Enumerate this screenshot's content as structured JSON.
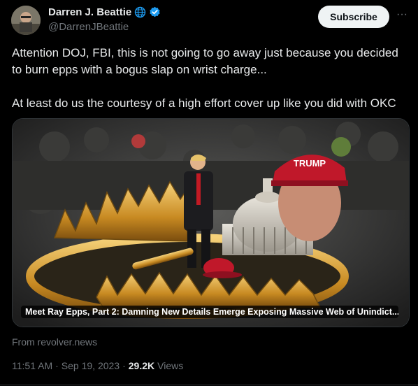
{
  "author": {
    "name": "Darren J. Beattie",
    "handle": "@DarrenJBeattie"
  },
  "actions": {
    "subscribe_label": "Subscribe",
    "more_label": "···"
  },
  "tweet": {
    "text": "Attention DOJ, FBI, this is not going to go away just because you decided to burn epps with a bogus slap on wrist charge...\n\nAt least do us the courtesy of a high effort cover up like you did with OKC"
  },
  "card": {
    "title": "Meet Ray Epps, Part 2: Damning New Details Emerge Exposing Massive Web of Unindict...",
    "source": "From revolver.news",
    "hat_text": "TRUMP"
  },
  "meta": {
    "time": "11:51 AM",
    "sep1": "·",
    "date": "Sep 19, 2023",
    "sep2": "·",
    "views_count": "29.2K",
    "views_label": "Views"
  },
  "colors": {
    "accent_blue": "#1d9bf0",
    "background": "#000000",
    "text": "#e7e9ea",
    "muted": "#71767b"
  }
}
